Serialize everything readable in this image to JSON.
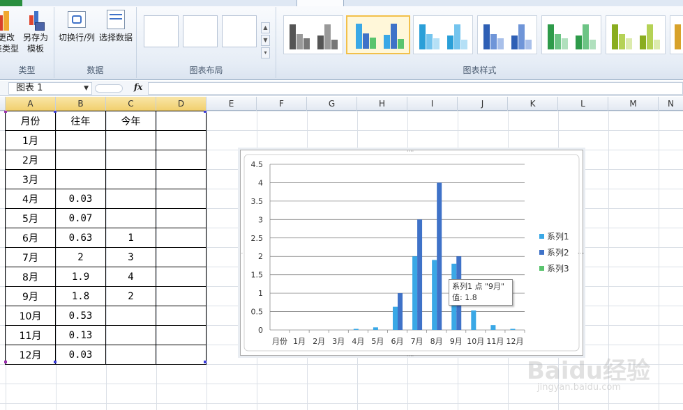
{
  "ribbon": {
    "groups": [
      {
        "label": "类型",
        "buttons": [
          "更改\n表类型",
          "另存为\n模板"
        ]
      },
      {
        "label": "数据",
        "buttons": [
          "切换行/列",
          "选择数据"
        ]
      },
      {
        "label": "图表布局"
      },
      {
        "label": "图表样式"
      }
    ]
  },
  "formula_bar": {
    "name_box": "图表 1",
    "fx": "fx",
    "formula": ""
  },
  "columns": [
    "A",
    "B",
    "C",
    "D",
    "E",
    "F",
    "G",
    "H",
    "I",
    "J",
    "K",
    "L",
    "M",
    "N"
  ],
  "table": {
    "header": [
      "月份",
      "往年",
      "今年",
      ""
    ],
    "rows": [
      [
        "1月",
        "",
        "",
        ""
      ],
      [
        "2月",
        "",
        "",
        ""
      ],
      [
        "3月",
        "",
        "",
        ""
      ],
      [
        "4月",
        "0.03",
        "",
        ""
      ],
      [
        "5月",
        "0.07",
        "",
        ""
      ],
      [
        "6月",
        "0.63",
        "1",
        ""
      ],
      [
        "7月",
        "2",
        "3",
        ""
      ],
      [
        "8月",
        "1.9",
        "4",
        ""
      ],
      [
        "9月",
        "1.8",
        "2",
        ""
      ],
      [
        "10月",
        "0.53",
        "",
        ""
      ],
      [
        "11月",
        "0.13",
        "",
        ""
      ],
      [
        "12月",
        "0.03",
        "",
        ""
      ]
    ]
  },
  "chart_data": {
    "type": "bar",
    "categories": [
      "月份",
      "1月",
      "2月",
      "3月",
      "4月",
      "5月",
      "6月",
      "7月",
      "8月",
      "9月",
      "10月",
      "11月",
      "12月"
    ],
    "series": [
      {
        "name": "系列1",
        "color": "#3aa8e6",
        "values": [
          0,
          0,
          0,
          0,
          0.03,
          0.07,
          0.63,
          2,
          1.9,
          1.8,
          0.53,
          0.13,
          0.03
        ]
      },
      {
        "name": "系列2",
        "color": "#3f72c8",
        "values": [
          0,
          0,
          0,
          0,
          0,
          0,
          1,
          3,
          4,
          2,
          0,
          0,
          0
        ]
      },
      {
        "name": "系列3",
        "color": "#5ac46e",
        "values": [
          0,
          0,
          0,
          0,
          0,
          0,
          0,
          0,
          0,
          0,
          0,
          0,
          0
        ]
      }
    ],
    "ylim": [
      0,
      4.5
    ],
    "yticks": [
      "0",
      "0.5",
      "1",
      "1.5",
      "2",
      "2.5",
      "3",
      "3.5",
      "4",
      "4.5"
    ],
    "grid": true,
    "legend": "right"
  },
  "tooltip": {
    "line1": "系列1 点 \"9月\"",
    "line2": "值: 1.8"
  },
  "watermark": {
    "text": "Baidu经验",
    "sub": "jingyan.baidu.com"
  }
}
